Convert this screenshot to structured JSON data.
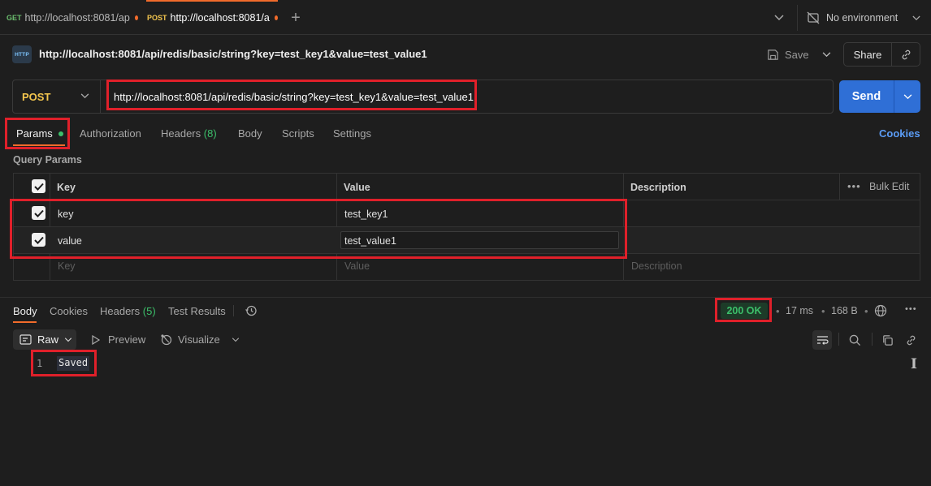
{
  "tabs": [
    {
      "method": "GET",
      "label": "http://localhost:8081/ap",
      "method_color": "#6bbd6e"
    },
    {
      "method": "POST",
      "label": "http://localhost:8081/a",
      "method_color": "#f4c64e"
    }
  ],
  "environment": "No environment",
  "request": {
    "title": "http://localhost:8081/api/redis/basic/string?key=test_key1&value=test_value1",
    "method": "POST",
    "url": "http://localhost:8081/api/redis/basic/string?key=test_key1&value=test_value1",
    "save_label": "Save",
    "share_label": "Share",
    "send_label": "Send",
    "http_badge": "HTTP"
  },
  "req_tabs": {
    "params": "Params",
    "authorization": "Authorization",
    "headers": "Headers",
    "headers_count": "(8)",
    "body": "Body",
    "scripts": "Scripts",
    "settings": "Settings",
    "cookies": "Cookies"
  },
  "query_params": {
    "title": "Query Params",
    "columns": {
      "key": "Key",
      "value": "Value",
      "description": "Description",
      "bulk_edit": "Bulk Edit"
    },
    "rows": [
      {
        "key": "key",
        "value": "test_key1",
        "checked": true
      },
      {
        "key": "value",
        "value": "test_value1",
        "checked": true
      }
    ],
    "placeholders": {
      "key": "Key",
      "value": "Value",
      "description": "Description"
    }
  },
  "response": {
    "tabs": {
      "body": "Body",
      "cookies": "Cookies",
      "headers": "Headers",
      "headers_count": "(5)",
      "tests": "Test Results"
    },
    "status": "200 OK",
    "time": "17 ms",
    "size": "168 B",
    "view_raw": "Raw",
    "view_preview": "Preview",
    "view_visualize": "Visualize",
    "line_number": "1",
    "line_text": "Saved"
  },
  "colors": {
    "accent": "#f26b2b",
    "send": "#2f6fd6",
    "status_green": "#3cbf6a",
    "highlight": "#e0202a"
  }
}
